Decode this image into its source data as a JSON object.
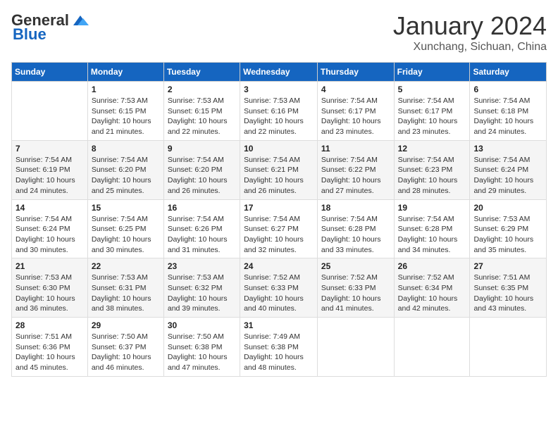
{
  "header": {
    "logo_general": "General",
    "logo_blue": "Blue",
    "month_title": "January 2024",
    "location": "Xunchang, Sichuan, China"
  },
  "columns": [
    "Sunday",
    "Monday",
    "Tuesday",
    "Wednesday",
    "Thursday",
    "Friday",
    "Saturday"
  ],
  "weeks": [
    [
      {
        "day": "",
        "sunrise": "",
        "sunset": "",
        "daylight": ""
      },
      {
        "day": "1",
        "sunrise": "Sunrise: 7:53 AM",
        "sunset": "Sunset: 6:15 PM",
        "daylight": "Daylight: 10 hours and 21 minutes."
      },
      {
        "day": "2",
        "sunrise": "Sunrise: 7:53 AM",
        "sunset": "Sunset: 6:15 PM",
        "daylight": "Daylight: 10 hours and 22 minutes."
      },
      {
        "day": "3",
        "sunrise": "Sunrise: 7:53 AM",
        "sunset": "Sunset: 6:16 PM",
        "daylight": "Daylight: 10 hours and 22 minutes."
      },
      {
        "day": "4",
        "sunrise": "Sunrise: 7:54 AM",
        "sunset": "Sunset: 6:17 PM",
        "daylight": "Daylight: 10 hours and 23 minutes."
      },
      {
        "day": "5",
        "sunrise": "Sunrise: 7:54 AM",
        "sunset": "Sunset: 6:17 PM",
        "daylight": "Daylight: 10 hours and 23 minutes."
      },
      {
        "day": "6",
        "sunrise": "Sunrise: 7:54 AM",
        "sunset": "Sunset: 6:18 PM",
        "daylight": "Daylight: 10 hours and 24 minutes."
      }
    ],
    [
      {
        "day": "7",
        "sunrise": "Sunrise: 7:54 AM",
        "sunset": "Sunset: 6:19 PM",
        "daylight": "Daylight: 10 hours and 24 minutes."
      },
      {
        "day": "8",
        "sunrise": "Sunrise: 7:54 AM",
        "sunset": "Sunset: 6:20 PM",
        "daylight": "Daylight: 10 hours and 25 minutes."
      },
      {
        "day": "9",
        "sunrise": "Sunrise: 7:54 AM",
        "sunset": "Sunset: 6:20 PM",
        "daylight": "Daylight: 10 hours and 26 minutes."
      },
      {
        "day": "10",
        "sunrise": "Sunrise: 7:54 AM",
        "sunset": "Sunset: 6:21 PM",
        "daylight": "Daylight: 10 hours and 26 minutes."
      },
      {
        "day": "11",
        "sunrise": "Sunrise: 7:54 AM",
        "sunset": "Sunset: 6:22 PM",
        "daylight": "Daylight: 10 hours and 27 minutes."
      },
      {
        "day": "12",
        "sunrise": "Sunrise: 7:54 AM",
        "sunset": "Sunset: 6:23 PM",
        "daylight": "Daylight: 10 hours and 28 minutes."
      },
      {
        "day": "13",
        "sunrise": "Sunrise: 7:54 AM",
        "sunset": "Sunset: 6:24 PM",
        "daylight": "Daylight: 10 hours and 29 minutes."
      }
    ],
    [
      {
        "day": "14",
        "sunrise": "Sunrise: 7:54 AM",
        "sunset": "Sunset: 6:24 PM",
        "daylight": "Daylight: 10 hours and 30 minutes."
      },
      {
        "day": "15",
        "sunrise": "Sunrise: 7:54 AM",
        "sunset": "Sunset: 6:25 PM",
        "daylight": "Daylight: 10 hours and 30 minutes."
      },
      {
        "day": "16",
        "sunrise": "Sunrise: 7:54 AM",
        "sunset": "Sunset: 6:26 PM",
        "daylight": "Daylight: 10 hours and 31 minutes."
      },
      {
        "day": "17",
        "sunrise": "Sunrise: 7:54 AM",
        "sunset": "Sunset: 6:27 PM",
        "daylight": "Daylight: 10 hours and 32 minutes."
      },
      {
        "day": "18",
        "sunrise": "Sunrise: 7:54 AM",
        "sunset": "Sunset: 6:28 PM",
        "daylight": "Daylight: 10 hours and 33 minutes."
      },
      {
        "day": "19",
        "sunrise": "Sunrise: 7:54 AM",
        "sunset": "Sunset: 6:28 PM",
        "daylight": "Daylight: 10 hours and 34 minutes."
      },
      {
        "day": "20",
        "sunrise": "Sunrise: 7:53 AM",
        "sunset": "Sunset: 6:29 PM",
        "daylight": "Daylight: 10 hours and 35 minutes."
      }
    ],
    [
      {
        "day": "21",
        "sunrise": "Sunrise: 7:53 AM",
        "sunset": "Sunset: 6:30 PM",
        "daylight": "Daylight: 10 hours and 36 minutes."
      },
      {
        "day": "22",
        "sunrise": "Sunrise: 7:53 AM",
        "sunset": "Sunset: 6:31 PM",
        "daylight": "Daylight: 10 hours and 38 minutes."
      },
      {
        "day": "23",
        "sunrise": "Sunrise: 7:53 AM",
        "sunset": "Sunset: 6:32 PM",
        "daylight": "Daylight: 10 hours and 39 minutes."
      },
      {
        "day": "24",
        "sunrise": "Sunrise: 7:52 AM",
        "sunset": "Sunset: 6:33 PM",
        "daylight": "Daylight: 10 hours and 40 minutes."
      },
      {
        "day": "25",
        "sunrise": "Sunrise: 7:52 AM",
        "sunset": "Sunset: 6:33 PM",
        "daylight": "Daylight: 10 hours and 41 minutes."
      },
      {
        "day": "26",
        "sunrise": "Sunrise: 7:52 AM",
        "sunset": "Sunset: 6:34 PM",
        "daylight": "Daylight: 10 hours and 42 minutes."
      },
      {
        "day": "27",
        "sunrise": "Sunrise: 7:51 AM",
        "sunset": "Sunset: 6:35 PM",
        "daylight": "Daylight: 10 hours and 43 minutes."
      }
    ],
    [
      {
        "day": "28",
        "sunrise": "Sunrise: 7:51 AM",
        "sunset": "Sunset: 6:36 PM",
        "daylight": "Daylight: 10 hours and 45 minutes."
      },
      {
        "day": "29",
        "sunrise": "Sunrise: 7:50 AM",
        "sunset": "Sunset: 6:37 PM",
        "daylight": "Daylight: 10 hours and 46 minutes."
      },
      {
        "day": "30",
        "sunrise": "Sunrise: 7:50 AM",
        "sunset": "Sunset: 6:38 PM",
        "daylight": "Daylight: 10 hours and 47 minutes."
      },
      {
        "day": "31",
        "sunrise": "Sunrise: 7:49 AM",
        "sunset": "Sunset: 6:38 PM",
        "daylight": "Daylight: 10 hours and 48 minutes."
      },
      {
        "day": "",
        "sunrise": "",
        "sunset": "",
        "daylight": ""
      },
      {
        "day": "",
        "sunrise": "",
        "sunset": "",
        "daylight": ""
      },
      {
        "day": "",
        "sunrise": "",
        "sunset": "",
        "daylight": ""
      }
    ]
  ]
}
